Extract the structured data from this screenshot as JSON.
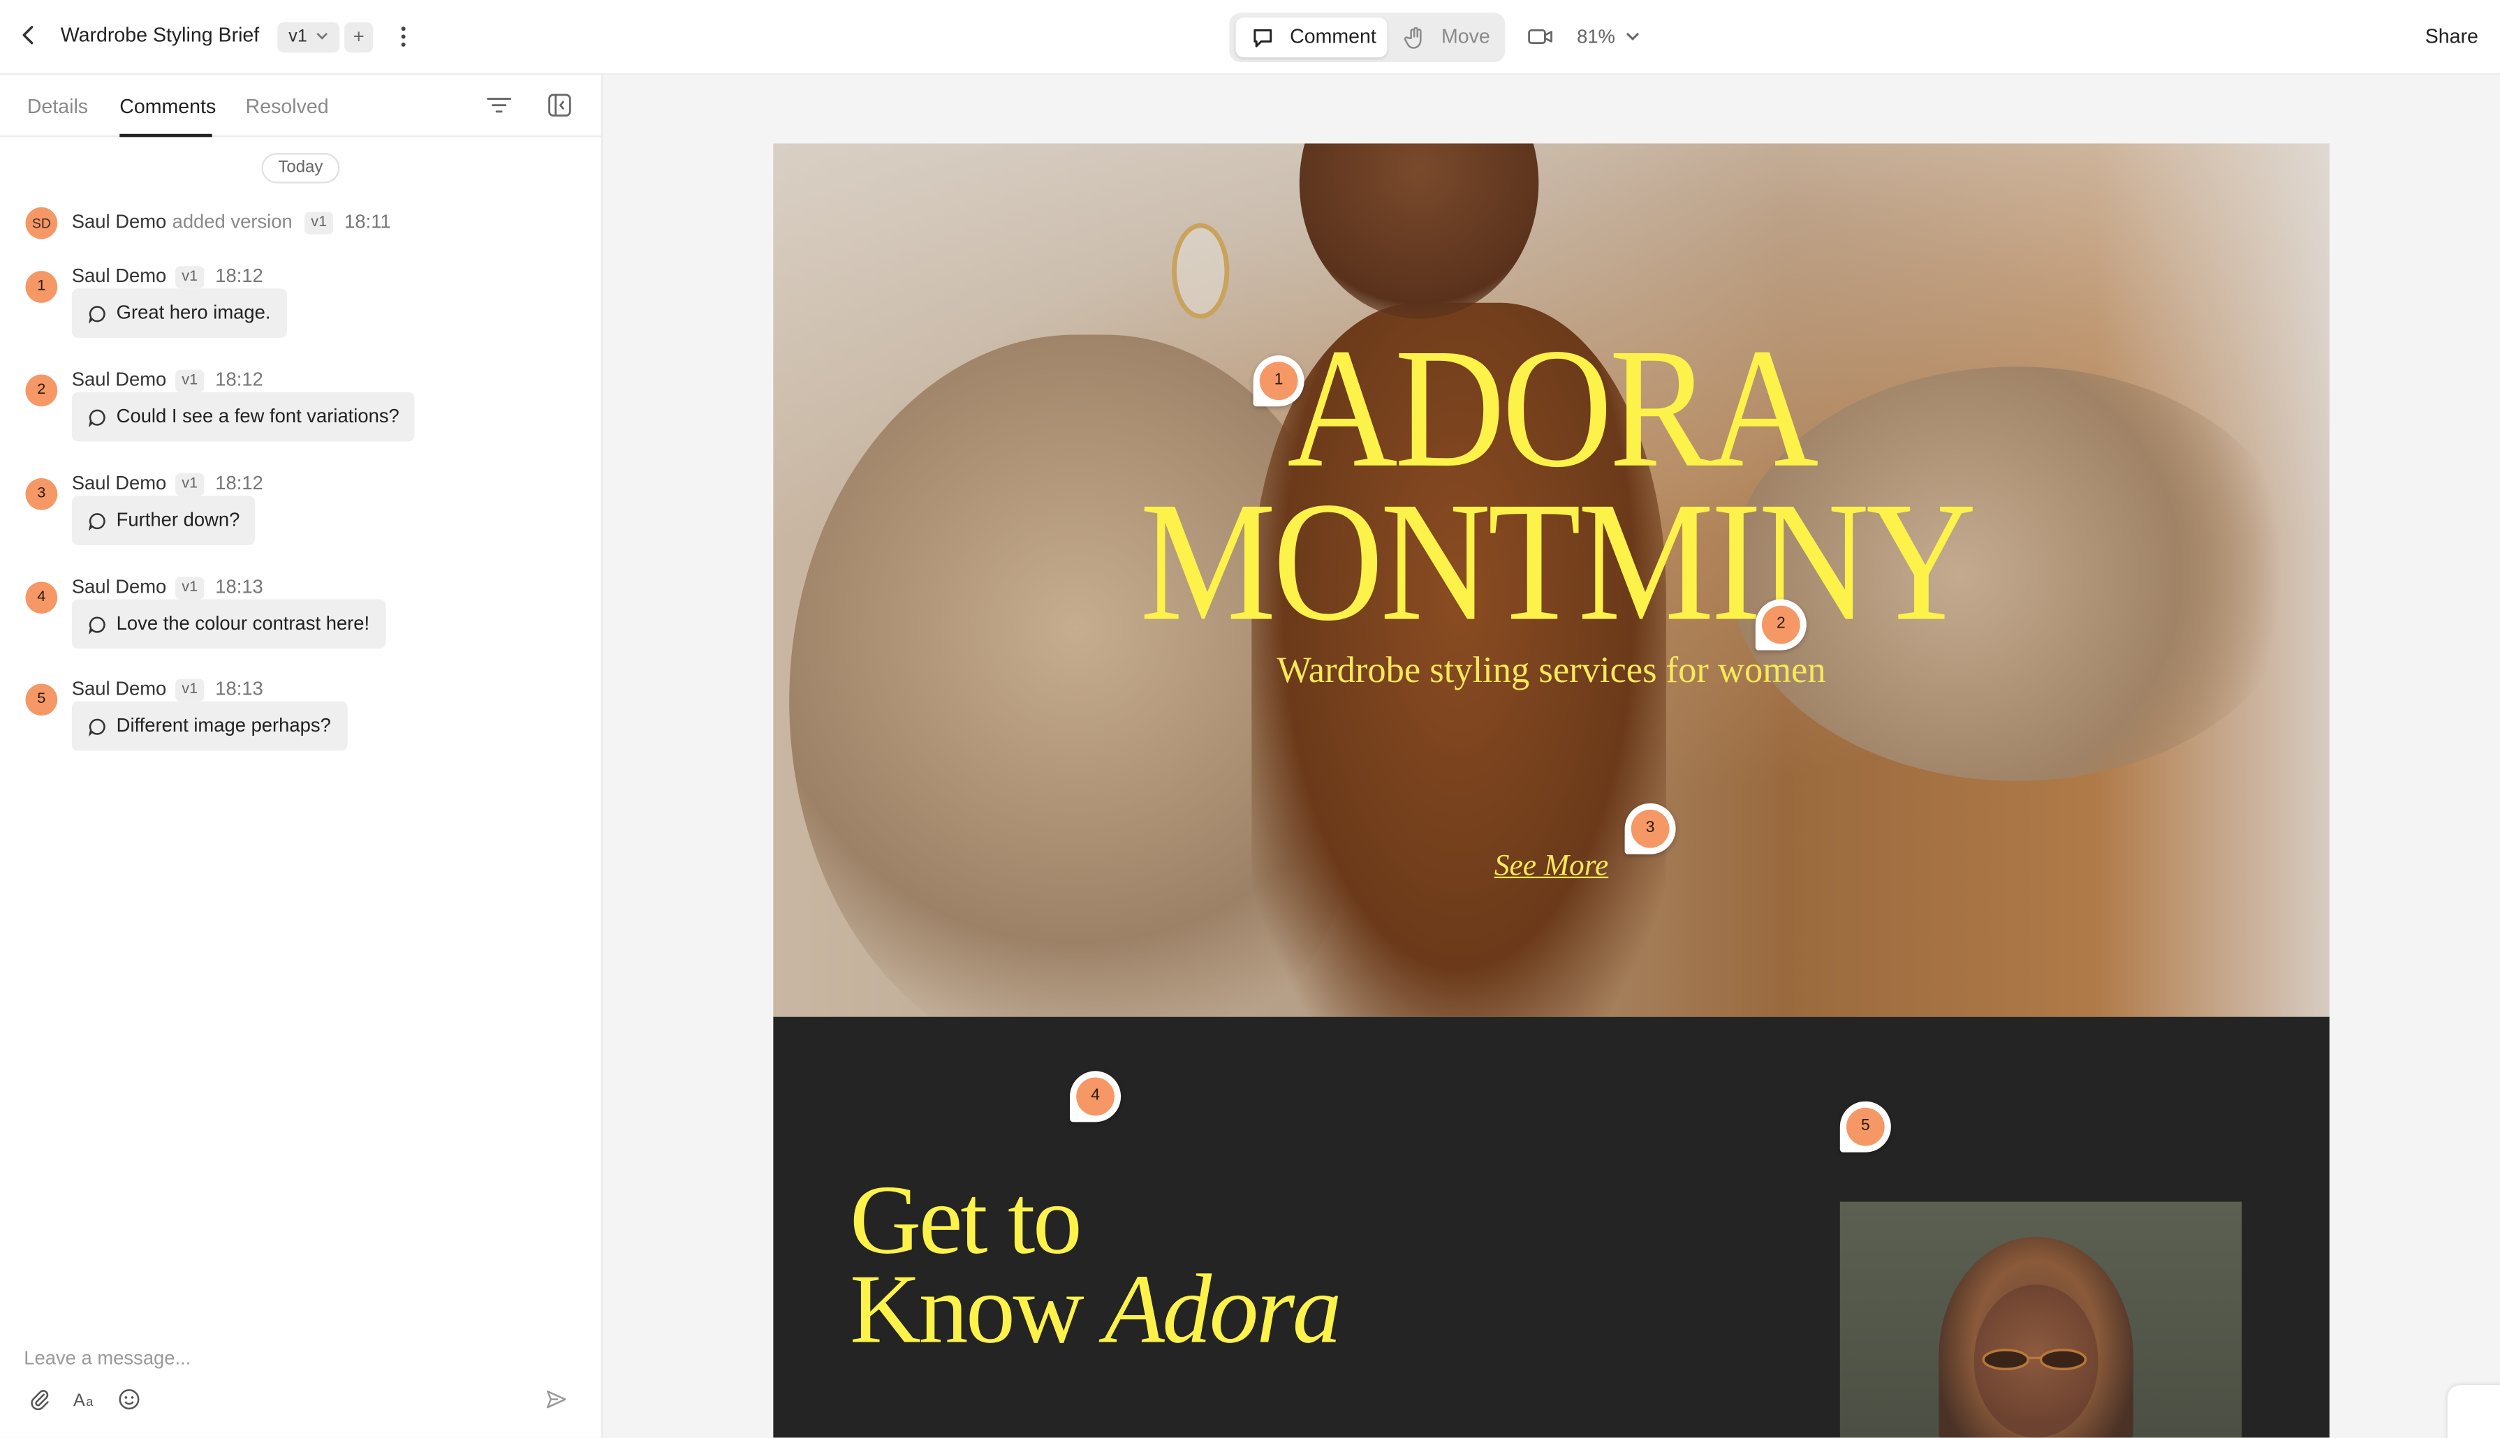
{
  "header": {
    "title": "Wardrobe Styling Brief",
    "version": "v1",
    "add_version": "+",
    "mode_comment": "Comment",
    "mode_move": "Move",
    "zoom": "81%",
    "share": "Share"
  },
  "sidebar": {
    "tabs": [
      "Details",
      "Comments",
      "Resolved"
    ],
    "active_tab": "Comments",
    "day_label": "Today",
    "activity": {
      "avatar": "SD",
      "user": "Saul Demo",
      "action": "added version",
      "version": "v1",
      "time": "18:11"
    },
    "comments": [
      {
        "number": "1",
        "user": "Saul Demo",
        "version": "v1",
        "time": "18:12",
        "text": "Great hero image."
      },
      {
        "number": "2",
        "user": "Saul Demo",
        "version": "v1",
        "time": "18:12",
        "text": "Could I see a few font variations?"
      },
      {
        "number": "3",
        "user": "Saul Demo",
        "version": "v1",
        "time": "18:12",
        "text": "Further down?"
      },
      {
        "number": "4",
        "user": "Saul Demo",
        "version": "v1",
        "time": "18:13",
        "text": "Love the colour contrast here!"
      },
      {
        "number": "5",
        "user": "Saul Demo",
        "version": "v1",
        "time": "18:13",
        "text": "Different image perhaps?"
      }
    ],
    "composer_placeholder": "Leave a message..."
  },
  "design": {
    "hero_title_line1": "ADORA",
    "hero_title_line2": "MONTMINY",
    "hero_subtitle": "Wardrobe styling services for women",
    "hero_link": "See More",
    "section_title_line1": "Get to",
    "section_title_line2a": "Know ",
    "section_title_line2b": "Adora",
    "pins": [
      "1",
      "2",
      "3",
      "4",
      "5"
    ]
  },
  "colors": {
    "accent_badge": "#f59866",
    "headline_yellow": "#fcf24a",
    "dark_section": "#242424"
  },
  "icons": {
    "back": "chevron-left-icon",
    "more": "kebab-icon",
    "comment": "speech-bubble-icon",
    "move": "hand-icon",
    "video": "video-camera-icon",
    "filter": "filter-icon",
    "collapse": "panel-collapse-icon",
    "attach": "paperclip-icon",
    "format": "text-format-icon",
    "emoji": "smiley-icon",
    "send": "send-icon"
  }
}
